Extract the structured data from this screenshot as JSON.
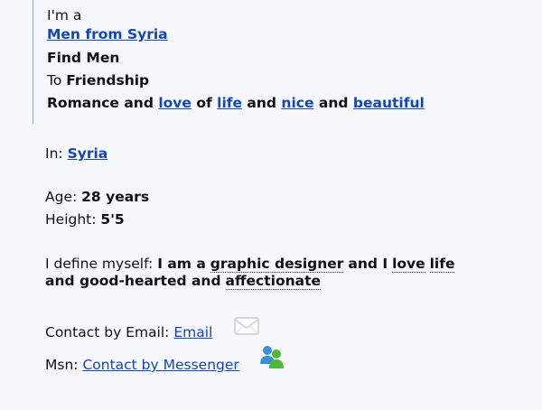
{
  "intro": {
    "im_a": "I'm a",
    "gender_link": "Men from Syria",
    "find_men": "Find Men",
    "to_label": "To",
    "to_value": "Friendship",
    "tags": {
      "prefix": "Romance and",
      "love": "love",
      "of": "of",
      "life": "life",
      "and1": "and",
      "nice": "nice",
      "and2": "and",
      "beautiful": "beautiful"
    }
  },
  "location": {
    "label": "In:",
    "value": "Syria"
  },
  "details": {
    "age_label": "Age:",
    "age_value": "28 years",
    "height_label": "Height:",
    "height_value": "5'5"
  },
  "define": {
    "label": "I define myself:",
    "p1": "I am a",
    "graphic_designer": "graphic designer",
    "p2": "and I",
    "love": "love",
    "life": "life",
    "p3": "and good-hearted and",
    "affectionate": "affectionate"
  },
  "contact": {
    "email_label": "Contact by Email:",
    "email_link": "Email",
    "msn_label": "Msn:",
    "msn_link": "Contact by Messenger"
  },
  "colors": {
    "link": "#1446b5",
    "background": "#f7f8fd",
    "rule": "#8fa3d6"
  }
}
